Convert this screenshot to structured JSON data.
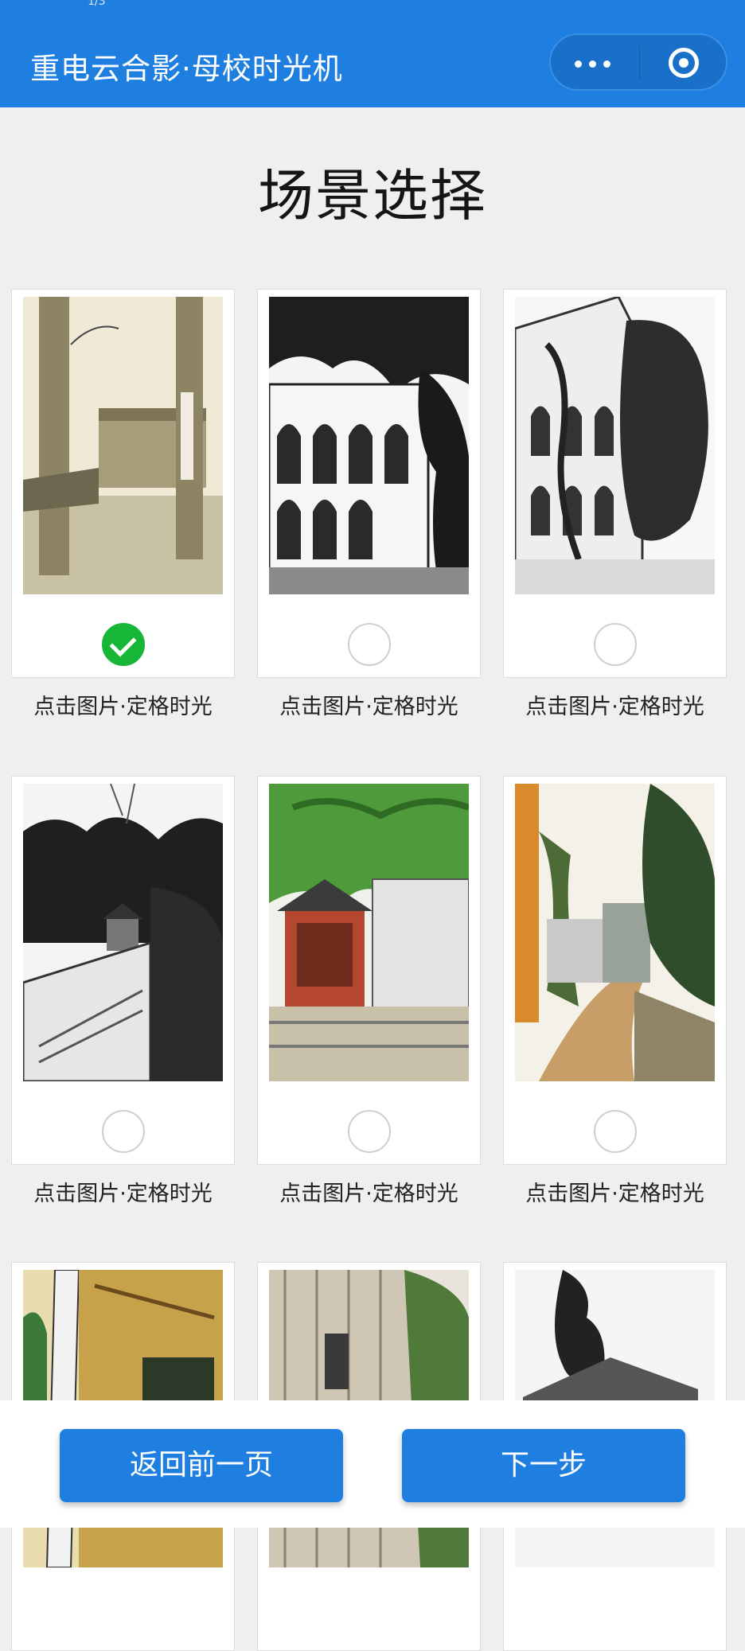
{
  "status_bar": {
    "text": "1/3"
  },
  "nav": {
    "title": "重电云合影·母校时光机",
    "menu_icon": "more-dots-icon",
    "close_icon": "target-icon",
    "background": "#1e7fe0"
  },
  "page": {
    "title": "场景选择"
  },
  "scenes": [
    {
      "caption": "点击图片·定格时光",
      "selected": true,
      "style": "sepia-campus-gate"
    },
    {
      "caption": "点击图片·定格时光",
      "selected": false,
      "style": "ink-arched-building"
    },
    {
      "caption": "点击图片·定格时光",
      "selected": false,
      "style": "ink-vine-building"
    },
    {
      "caption": "点击图片·定格时光",
      "selected": false,
      "style": "ink-pavilion-stairs"
    },
    {
      "caption": "点击图片·定格时光",
      "selected": false,
      "style": "color-red-pavilion"
    },
    {
      "caption": "点击图片·定格时光",
      "selected": false,
      "style": "color-campus-path"
    },
    {
      "caption": "",
      "selected": false,
      "style": "color-hallway"
    },
    {
      "caption": "",
      "selected": false,
      "style": "color-tall-building"
    },
    {
      "caption": "",
      "selected": false,
      "style": "ink-tree"
    }
  ],
  "footer": {
    "back_label": "返回前一页",
    "next_label": "下一步"
  },
  "colors": {
    "accent": "#1e7fe0",
    "selected": "#17b636"
  }
}
